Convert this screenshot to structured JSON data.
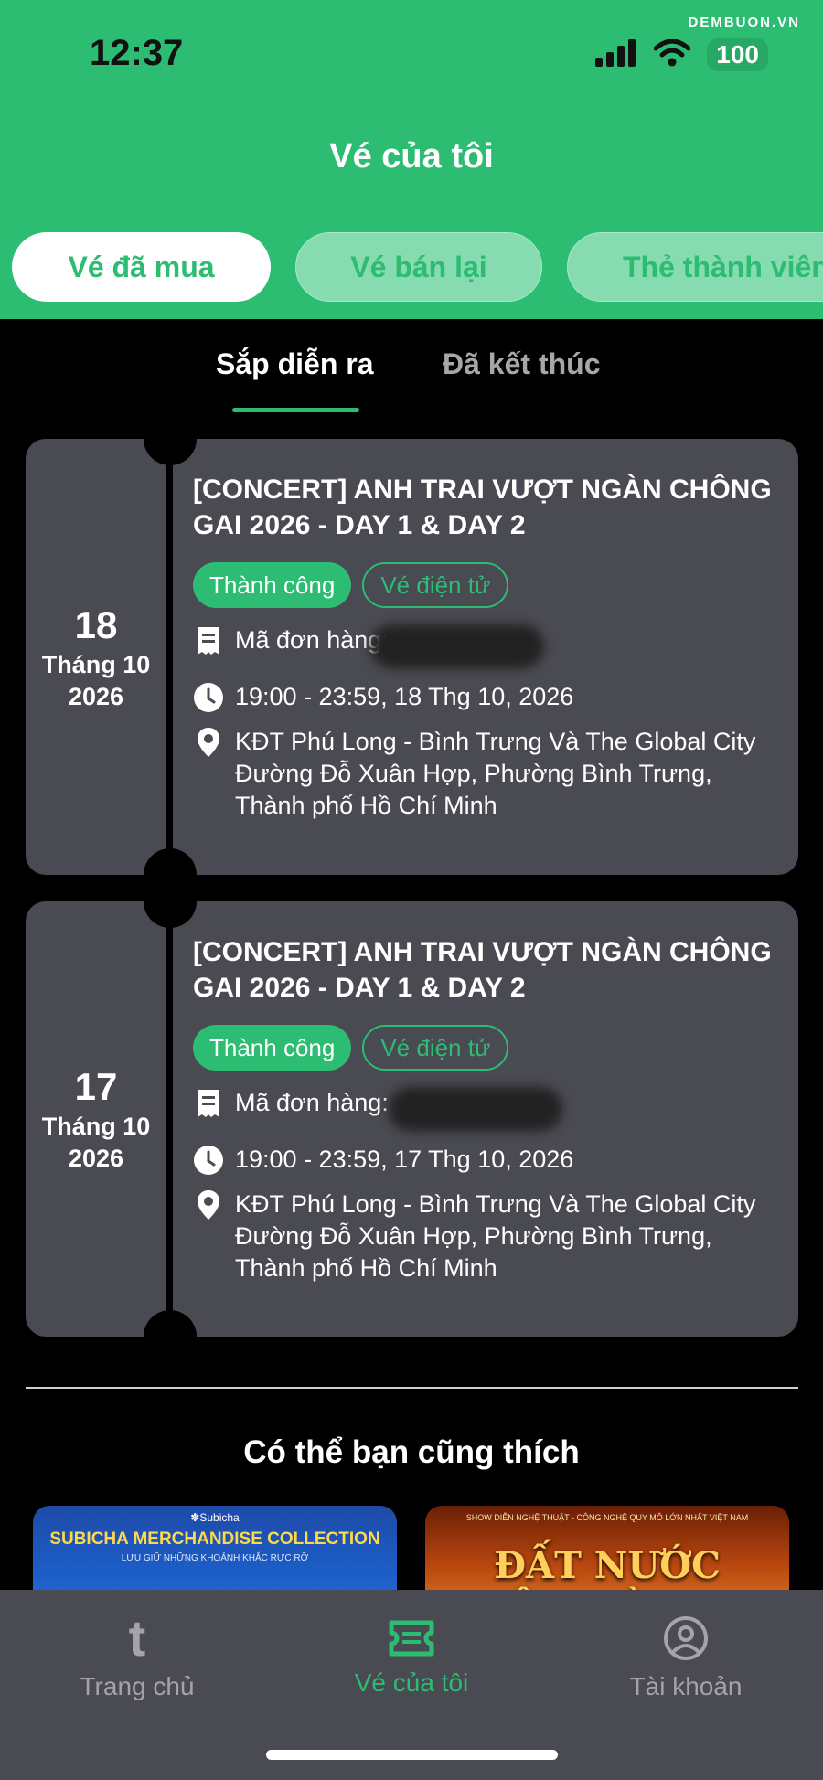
{
  "status_bar": {
    "time": "12:37",
    "battery": "100",
    "watermark": "DEMBUON.VN"
  },
  "header": {
    "title": "Vé của tôi"
  },
  "top_tabs": [
    {
      "label": "Vé đã mua",
      "active": true
    },
    {
      "label": "Vé bán lại",
      "active": false
    },
    {
      "label": "Thẻ thành viên",
      "active": false
    }
  ],
  "sub_tabs": [
    {
      "label": "Sắp diễn ra",
      "active": true
    },
    {
      "label": "Đã kết thúc",
      "active": false
    }
  ],
  "tickets": [
    {
      "day": "18",
      "month": "Tháng 10",
      "year": "2026",
      "title": "[CONCERT] ANH TRAI VƯỢT NGÀN CHÔNG GAI 2026 - DAY 1 & DAY 2",
      "status": "Thành công",
      "type": "Vé điện tử",
      "order_label": "Mã đơn hàng:",
      "time": "19:00 - 23:59, 18 Thg 10, 2026",
      "venue_line1": "KĐT Phú Long - Bình Trưng Và The Global City",
      "venue_line2": "Đường Đỗ Xuân Hợp, Phường Bình Trưng, Thành phố Hồ Chí Minh"
    },
    {
      "day": "17",
      "month": "Tháng 10",
      "year": "2026",
      "title": "[CONCERT] ANH TRAI VƯỢT NGÀN CHÔNG GAI 2026 - DAY 1 & DAY 2",
      "status": "Thành công",
      "type": "Vé điện tử",
      "order_label": "Mã đơn hàng:",
      "time": "19:00 - 23:59, 17 Thg 10, 2026",
      "venue_line1": "KĐT Phú Long - Bình Trưng Và The Global City",
      "venue_line2": "Đường Đỗ Xuân Hợp, Phường Bình Trưng, Thành phố Hồ Chí Minh"
    }
  ],
  "recommended": {
    "title": "Có thể bạn cũng thích",
    "items": [
      {
        "brand": "✽Subicha",
        "name": "SUBICHA MERCHANDISE COLLECTION",
        "sub": "LƯU GIỮ NHỮNG KHOẢNH KHẮC RỰC RỠ"
      },
      {
        "small": "SHOW DIỄN NGHỆ THUẬT - CÔNG NGHỆ QUY MÔ LỚN NHẤT VIỆT NAM",
        "name": "ĐẤT NƯỚC THIÊN HÙNG CA"
      }
    ]
  },
  "bottom_nav": [
    {
      "label": "Trang chủ",
      "icon": "home-t-icon",
      "active": false
    },
    {
      "label": "Vé của tôi",
      "icon": "ticket-icon",
      "active": true
    },
    {
      "label": "Tài khoản",
      "icon": "account-icon",
      "active": false
    }
  ],
  "colors": {
    "accent": "#2dbd72",
    "card": "#4a4a52",
    "background": "#000000"
  }
}
